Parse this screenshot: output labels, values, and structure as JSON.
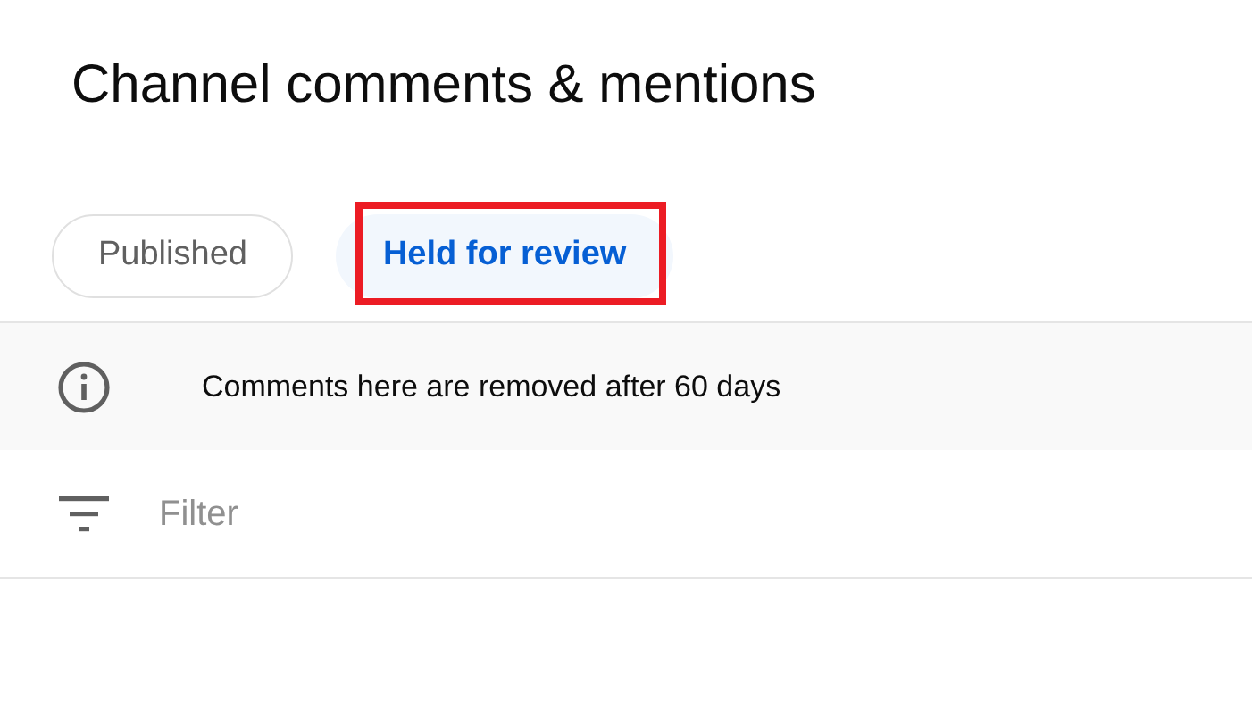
{
  "title": "Channel comments & mentions",
  "tabs": [
    {
      "label": "Published",
      "selected": false,
      "highlighted": false
    },
    {
      "label": "Held for review",
      "selected": true,
      "highlighted": true
    }
  ],
  "notice": {
    "text": "Comments here are removed after 60 days"
  },
  "filter": {
    "placeholder": "Filter"
  }
}
